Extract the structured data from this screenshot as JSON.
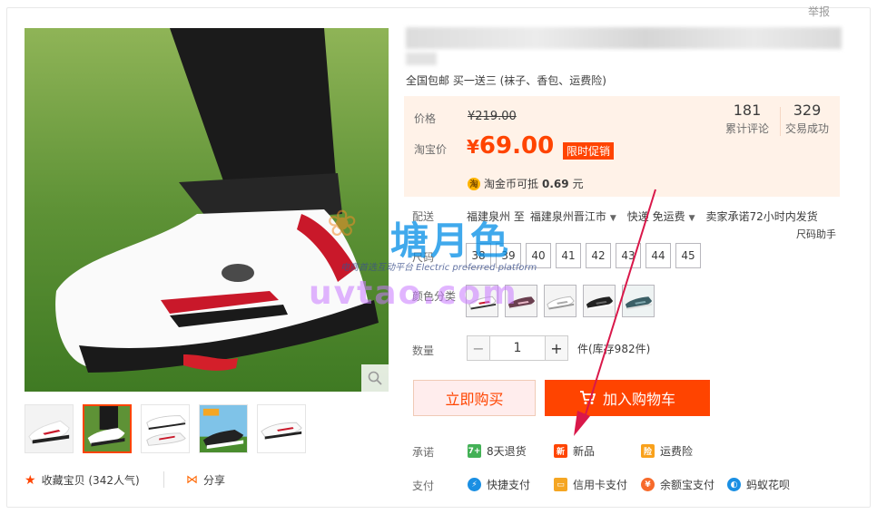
{
  "report_label": "举报",
  "subtitle": "全国包邮 买一送三 (袜子、香包、运费险)",
  "price": {
    "orig_label": "价格",
    "orig_value": "¥219.00",
    "now_label": "淘宝价",
    "now_currency": "¥",
    "now_value": "69.00",
    "promo_tag": "限时促销"
  },
  "stats": {
    "reviews_count": "181",
    "reviews_label": "累计评论",
    "deals_count": "329",
    "deals_label": "交易成功"
  },
  "coin": {
    "icon": "淘",
    "text": "淘金币可抵",
    "value": "0.69",
    "unit": "元"
  },
  "delivery": {
    "label": "配送",
    "from": "福建泉州 至",
    "to": "福建泉州晋江市",
    "express": "快递 免运费",
    "promise": "卖家承诺72小时内发货"
  },
  "size_helper": "尺码助手",
  "size": {
    "label": "尺码",
    "options": [
      "38",
      "39",
      "40",
      "41",
      "42",
      "43",
      "44",
      "45"
    ]
  },
  "color": {
    "label": "颜色分类"
  },
  "quantity": {
    "label": "数量",
    "minus": "−",
    "value": "1",
    "plus": "+",
    "stock": "件(库存982件)"
  },
  "buttons": {
    "buy_now": "立即购买",
    "add_cart": "加入购物车"
  },
  "promise": {
    "label": "承诺",
    "items": [
      "8天退货",
      "新品",
      "运费险"
    ]
  },
  "payment": {
    "label": "支付",
    "items": [
      "快捷支付",
      "信用卡支付",
      "余额宝支付",
      "蚂蚁花呗"
    ]
  },
  "favorite": "收藏宝贝 (342人气)",
  "share": "分享",
  "watermark": {
    "logo": "塘月色",
    "sub": "电商首选互动平台 Electric preferred platform",
    "url": "uvtao.com"
  },
  "colors": {
    "accent": "#ff4400",
    "price_bg": "#fff2e8"
  }
}
